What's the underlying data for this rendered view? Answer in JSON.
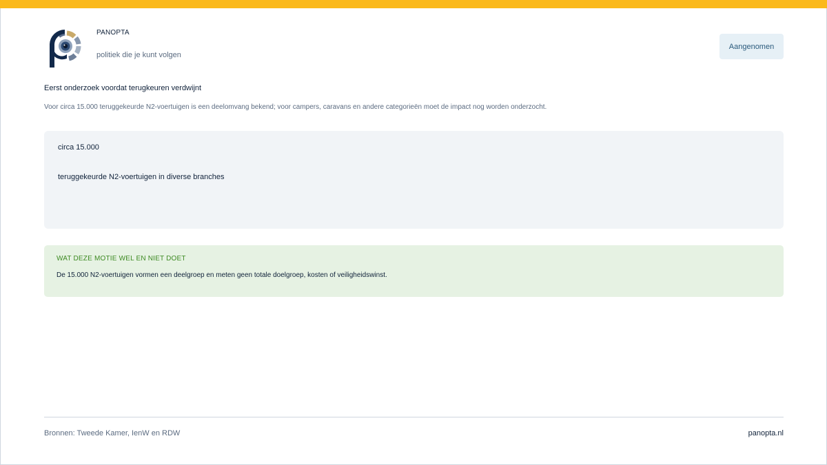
{
  "brand": {
    "name": "PANOPTA",
    "tagline": "politiek die je kunt volgen"
  },
  "status": {
    "label": "Aangenomen"
  },
  "motion": {
    "headline": "Eerst onderzoek voordat terugkeuren verdwijnt",
    "subtext": "Voor circa 15.000 teruggekeurde N2-voertuigen is een deelomvang bekend; voor campers, caravans en andere categorieën moet de impact nog worden onderzocht."
  },
  "stat": {
    "value": "circa 15.000",
    "label": "teruggekeurde N2-voertuigen in diverse branches"
  },
  "note": {
    "title": "WAT DEZE MOTIE WEL EN NIET DOET",
    "body": "De 15.000 N2-voertuigen vormen een deelgroep en meten geen totale doelgroep, kosten of veiligheidswinst."
  },
  "footer": {
    "sources": "Bronnen: Tweede Kamer, IenW en RDW",
    "site": "panopta.nl"
  },
  "colors": {
    "accent_bar": "#fbb91b",
    "brand_navy": "#10223a",
    "status_bg": "#e6f0f6",
    "note_bg": "#e6f2e3",
    "note_title": "#3d8a22"
  }
}
